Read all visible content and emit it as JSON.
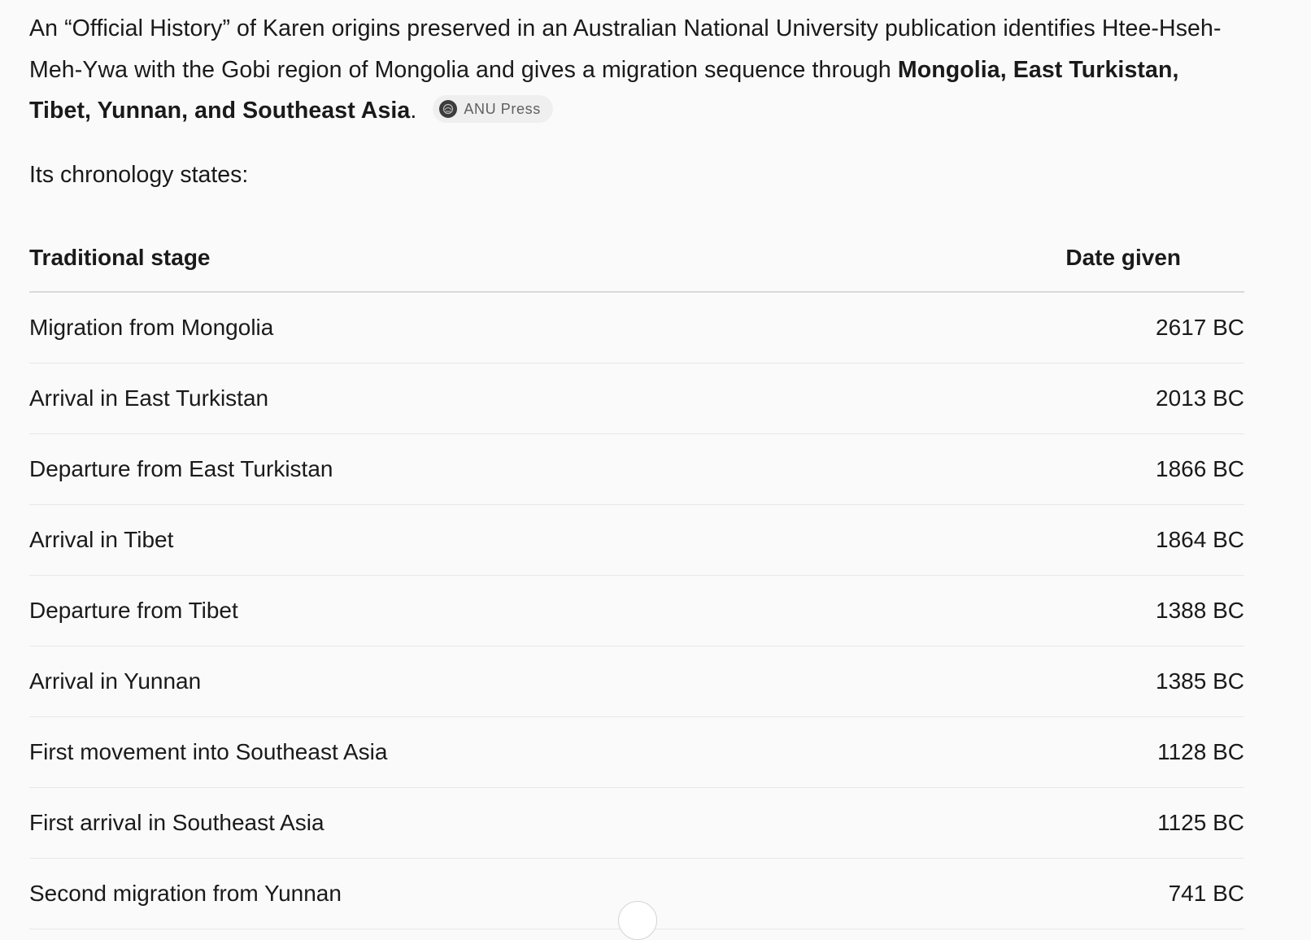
{
  "paragraph": {
    "text_part1": "An “Official History” of Karen origins preserved in an Australian National University publication identifies Htee-Hseh-Meh-Ywa with the Gobi region of Mongolia and gives a migration sequence through ",
    "bold_part": "Mongolia, East Turkistan, Tibet, Yunnan, and Southeast Asia",
    "text_part2": ".",
    "citation": {
      "label": "ANU Press",
      "icon": "source-favicon-icon"
    }
  },
  "lead_text": "Its chronology states:",
  "table": {
    "headers": {
      "stage": "Traditional stage",
      "date": "Date given"
    },
    "rows": [
      {
        "stage": "Migration from Mongolia",
        "date": "2617 BC"
      },
      {
        "stage": "Arrival in East Turkistan",
        "date": "2013 BC"
      },
      {
        "stage": "Departure from East Turkistan",
        "date": "1866 BC"
      },
      {
        "stage": "Arrival in Tibet",
        "date": "1864 BC"
      },
      {
        "stage": "Departure from Tibet",
        "date": "1388 BC"
      },
      {
        "stage": "Arrival in Yunnan",
        "date": "1385 BC"
      },
      {
        "stage": "First movement into Southeast Asia",
        "date": "1128 BC"
      },
      {
        "stage": "First arrival in Southeast Asia",
        "date": "1125 BC"
      },
      {
        "stage": "Second migration from Yunnan",
        "date": "741 BC"
      }
    ]
  },
  "scroll_button": {
    "icon": "scroll-down-icon"
  }
}
